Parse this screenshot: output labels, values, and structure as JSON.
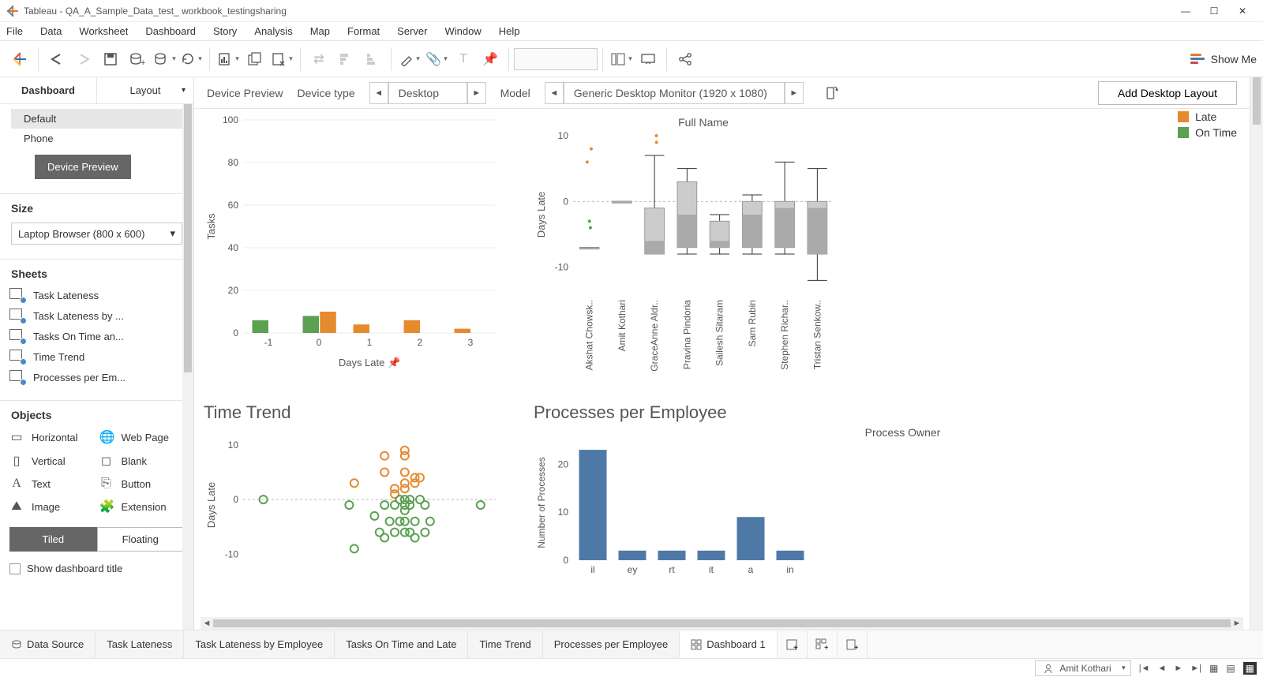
{
  "window_title": "Tableau - QA_A_Sample_Data_test_ workbook_testingsharing",
  "menu": [
    "File",
    "Data",
    "Worksheet",
    "Dashboard",
    "Story",
    "Analysis",
    "Map",
    "Format",
    "Server",
    "Window",
    "Help"
  ],
  "show_me": "Show Me",
  "left_panel": {
    "tab_dashboard": "Dashboard",
    "tab_layout": "Layout",
    "devices": {
      "default": "Default",
      "phone": "Phone"
    },
    "device_preview_btn": "Device Preview",
    "size_title": "Size",
    "size_value": "Laptop Browser (800 x 600)",
    "sheets_title": "Sheets",
    "sheets": [
      "Task Lateness",
      "Task Lateness by ...",
      "Tasks On Time an...",
      "Time Trend",
      "Processes per Em..."
    ],
    "objects_title": "Objects",
    "objects": {
      "horizontal": "Horizontal",
      "webpage": "Web Page",
      "vertical": "Vertical",
      "blank": "Blank",
      "text": "Text",
      "button": "Button",
      "image": "Image",
      "extension": "Extension"
    },
    "toggle_tiled": "Tiled",
    "toggle_floating": "Floating",
    "show_title": "Show dashboard title"
  },
  "device_bar": {
    "preview": "Device Preview",
    "type_label": "Device type",
    "type_value": "Desktop",
    "model_label": "Model",
    "model_value": "Generic Desktop Monitor (1920 x 1080)",
    "add_layout": "Add Desktop Layout"
  },
  "chart_data": [
    {
      "id": "tasks_hist",
      "type": "bar",
      "xlabel": "Days Late",
      "ylabel": "Tasks",
      "ylim": [
        0,
        100
      ],
      "yticks": [
        0,
        20,
        40,
        60,
        80,
        100
      ],
      "categories": [
        "-1",
        "0",
        "1",
        "2",
        "3"
      ],
      "series": [
        {
          "name": "On Time",
          "color": "#5ba053",
          "values": [
            6,
            8,
            0,
            0,
            0
          ]
        },
        {
          "name": "Late",
          "color": "#e68a2e",
          "values": [
            0,
            10,
            4,
            6,
            2
          ]
        }
      ]
    },
    {
      "id": "box_per_employee",
      "type": "boxplot",
      "subtitle": "Full Name",
      "ylabel": "Days Late",
      "ylim": [
        -14,
        10
      ],
      "yticks": [
        -10,
        0,
        10
      ],
      "categories": [
        "Akshat Chowsk..",
        "Amit Kothari",
        "GraceAnne Aldr..",
        "Pravina Pindoria",
        "Sailesh Sitaram",
        "Sam Rubin",
        "Stephen Richar..",
        "Tristan Senkow.."
      ],
      "boxes": [
        {
          "min": -7,
          "q1": -7,
          "median": -7,
          "q3": -7,
          "max": -7,
          "outliers": [
            8,
            6,
            -3,
            -4
          ]
        },
        {
          "min": 0,
          "q1": 0,
          "median": 0,
          "q3": 0,
          "max": 0,
          "outliers": []
        },
        {
          "min": -8,
          "q1": -8,
          "median": -6,
          "q3": -1,
          "max": 7,
          "outliers": [
            10,
            9
          ]
        },
        {
          "min": -8,
          "q1": -7,
          "median": -2,
          "q3": 3,
          "max": 5,
          "outliers": []
        },
        {
          "min": -8,
          "q1": -7,
          "median": -6,
          "q3": -3,
          "max": -2,
          "outliers": []
        },
        {
          "min": -8,
          "q1": -7,
          "median": -2,
          "q3": 0,
          "max": 1,
          "outliers": []
        },
        {
          "min": -8,
          "q1": -7,
          "median": -1,
          "q3": 0,
          "max": 6,
          "outliers": []
        },
        {
          "min": -12,
          "q1": -8,
          "median": -1,
          "q3": 0,
          "max": 5,
          "outliers": []
        }
      ],
      "legend": [
        {
          "name": "Late",
          "color": "#e68a2e"
        },
        {
          "name": "On Time",
          "color": "#5ba053"
        }
      ]
    },
    {
      "id": "time_trend",
      "type": "scatter",
      "title": "Time Trend",
      "ylabel": "Days Late",
      "ylim": [
        -14,
        12
      ],
      "yticks": [
        -10,
        0,
        10
      ],
      "series": [
        {
          "name": "Late",
          "color": "#e68a2e",
          "points": [
            [
              3.0,
              3
            ],
            [
              3.6,
              5
            ],
            [
              3.6,
              8
            ],
            [
              3.8,
              1
            ],
            [
              3.8,
              2
            ],
            [
              4.0,
              9
            ],
            [
              4.0,
              8
            ],
            [
              4.0,
              5
            ],
            [
              4.0,
              3
            ],
            [
              4.0,
              2
            ],
            [
              4.2,
              4
            ],
            [
              4.2,
              3
            ],
            [
              4.3,
              4
            ]
          ]
        },
        {
          "name": "On Time",
          "color": "#5ba053",
          "points": [
            [
              1.2,
              0
            ],
            [
              2.9,
              -1
            ],
            [
              3.0,
              -9
            ],
            [
              3.4,
              -3
            ],
            [
              3.5,
              -6
            ],
            [
              3.6,
              -1
            ],
            [
              3.6,
              -7
            ],
            [
              3.7,
              -4
            ],
            [
              3.8,
              -1
            ],
            [
              3.8,
              -6
            ],
            [
              3.9,
              0
            ],
            [
              3.9,
              -4
            ],
            [
              4.0,
              0
            ],
            [
              4.0,
              -1
            ],
            [
              4.0,
              -2
            ],
            [
              4.0,
              -4
            ],
            [
              4.0,
              -6
            ],
            [
              4.1,
              0
            ],
            [
              4.1,
              -1
            ],
            [
              4.1,
              -6
            ],
            [
              4.2,
              -4
            ],
            [
              4.2,
              -7
            ],
            [
              4.3,
              0
            ],
            [
              4.4,
              -1
            ],
            [
              4.4,
              -6
            ],
            [
              4.5,
              -4
            ],
            [
              5.5,
              -1
            ]
          ]
        }
      ]
    },
    {
      "id": "proc_per_emp",
      "type": "bar",
      "title": "Processes per Employee",
      "subtitle": "Process Owner",
      "ylabel": "Number of Processes",
      "ylim": [
        0,
        24
      ],
      "yticks": [
        0,
        10,
        20
      ],
      "categories": [
        "il",
        "ey",
        "rt",
        "it",
        "a",
        "in"
      ],
      "values": [
        23,
        2,
        2,
        2,
        9,
        2
      ],
      "color": "#4e79a7"
    }
  ],
  "bottom_tabs": {
    "data_source": "Data Source",
    "tabs": [
      "Task Lateness",
      "Task Lateness by Employee",
      "Tasks On Time and Late",
      "Time Trend",
      "Processes per Employee"
    ],
    "active": "Dashboard 1"
  },
  "status": {
    "user": "Amit Kothari"
  }
}
